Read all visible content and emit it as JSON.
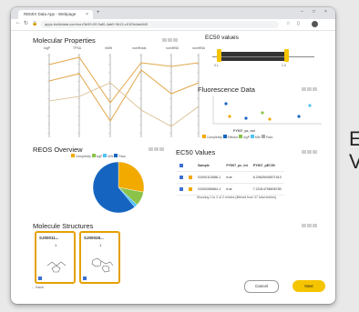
{
  "right_text": {
    "line1": "E",
    "line2": "V"
  },
  "browser": {
    "tab_title": "REMIX Data App - Webpage",
    "tab_close": "×",
    "new_tab": "+",
    "url": "apps.builddata.com/run/3e59-09 5af0-4ab9 9b13-c01f3b4ab849",
    "win_min": "–",
    "win_max": "□",
    "win_close": "×"
  },
  "panels": {
    "molecular_properties": "Molecular Properties",
    "ec50_values_slider": "EC50 values",
    "fluorescence": "Fluorescence Data",
    "reos": "REOS Overview",
    "ec50_table": "EC50 Values",
    "structures": "Molecule Structures"
  },
  "parallel_axes": [
    "logP",
    "TPSA",
    "nMW",
    "numRotat..",
    "numHBD",
    "numHBA"
  ],
  "slider": {
    "min_label": "0.1",
    "max_label": "1.0"
  },
  "scatter": {
    "xlabel": "PY507_pc_nol",
    "ylabel": "PY507_pc_mean",
    "x_ticks": [
      "40",
      "60",
      "80",
      "100",
      "120",
      "140",
      "160"
    ],
    "y_ticks": [
      "110",
      "100",
      "90"
    ],
    "legend": [
      "Complexity",
      "Effector",
      "logP",
      "MW",
      "Pass"
    ]
  },
  "reos_legend": [
    "Complexity",
    "logP",
    "MW",
    "Pass"
  ],
  "chart_data": {
    "type": "pie",
    "categories": [
      "Complexity",
      "logP",
      "MW",
      "Pass"
    ],
    "values": [
      28,
      9,
      2,
      61
    ],
    "colors": [
      "#f2a900",
      "#8bc34a",
      "#4fc3f7",
      "#1565c0"
    ]
  },
  "ec50_table": {
    "headers": [
      "Sample",
      "PY507_pc_lnt",
      "PY507_pEC50"
    ],
    "rows": [
      [
        "SJ000113086-1",
        "true",
        "6.20825945571910"
      ],
      [
        "SJ000280864-1",
        "true",
        "7.22414798635780"
      ]
    ],
    "footer": "Showing 1 to 2 of 2 entries (filtered from 37 total entries)"
  },
  "molecules": [
    {
      "id": "SJ00011...",
      "n": "1"
    },
    {
      "id": "SJ00028...",
      "n": "1"
    }
  ],
  "footer": {
    "back": "Back",
    "cancel": "Cancel",
    "next": "Next"
  }
}
